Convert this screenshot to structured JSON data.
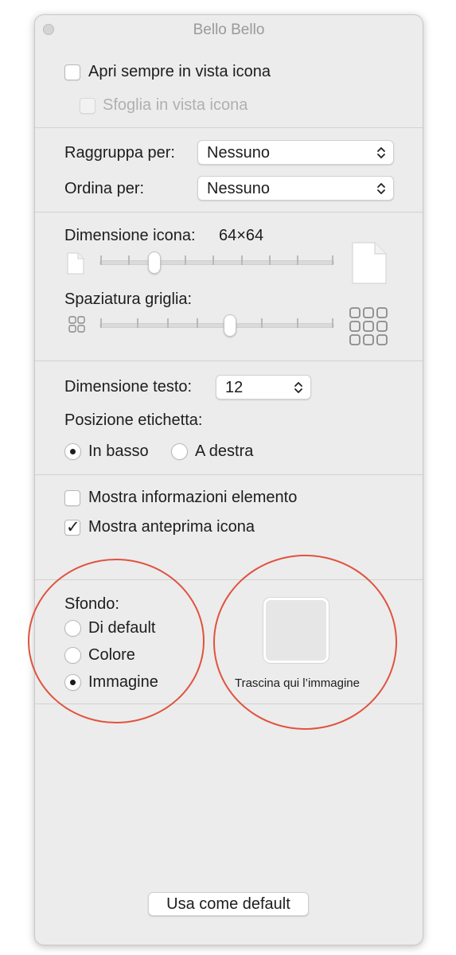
{
  "window": {
    "title": "Bello Bello"
  },
  "section_open": {
    "always_icon_view": {
      "label": "Apri sempre in vista icona",
      "checked": false
    },
    "browse_icon_view": {
      "label": "Sfoglia in vista icona",
      "checked": false,
      "enabled": false
    }
  },
  "section_sort": {
    "group_by": {
      "label": "Raggruppa per:",
      "value": "Nessuno"
    },
    "sort_by": {
      "label": "Ordina per:",
      "value": "Nessuno"
    }
  },
  "section_size": {
    "icon_size": {
      "label": "Dimensione icona:",
      "value": "64×64",
      "level": 0.22
    },
    "grid_spacing": {
      "label": "Spaziatura griglia:",
      "level": 0.56
    }
  },
  "section_text": {
    "text_size": {
      "label": "Dimensione testo:",
      "value": "12"
    },
    "label_position": {
      "label": "Posizione etichetta:",
      "options": [
        {
          "label": "In basso",
          "selected": true
        },
        {
          "label": "A destra",
          "selected": false
        }
      ]
    }
  },
  "section_show": {
    "show_item_info": {
      "label": "Mostra informazioni elemento",
      "checked": false
    },
    "show_icon_preview": {
      "label": "Mostra anteprima icona",
      "checked": true
    }
  },
  "section_background": {
    "label": "Sfondo:",
    "options": [
      {
        "label": "Di default",
        "selected": false
      },
      {
        "label": "Colore",
        "selected": false
      },
      {
        "label": "Immagine",
        "selected": true
      }
    ],
    "drop_hint": "Trascina qui l’immagine"
  },
  "footer": {
    "use_default_button": "Usa come default"
  },
  "colors": {
    "annotation": "#e0533f",
    "window_bg": "#ececec"
  }
}
